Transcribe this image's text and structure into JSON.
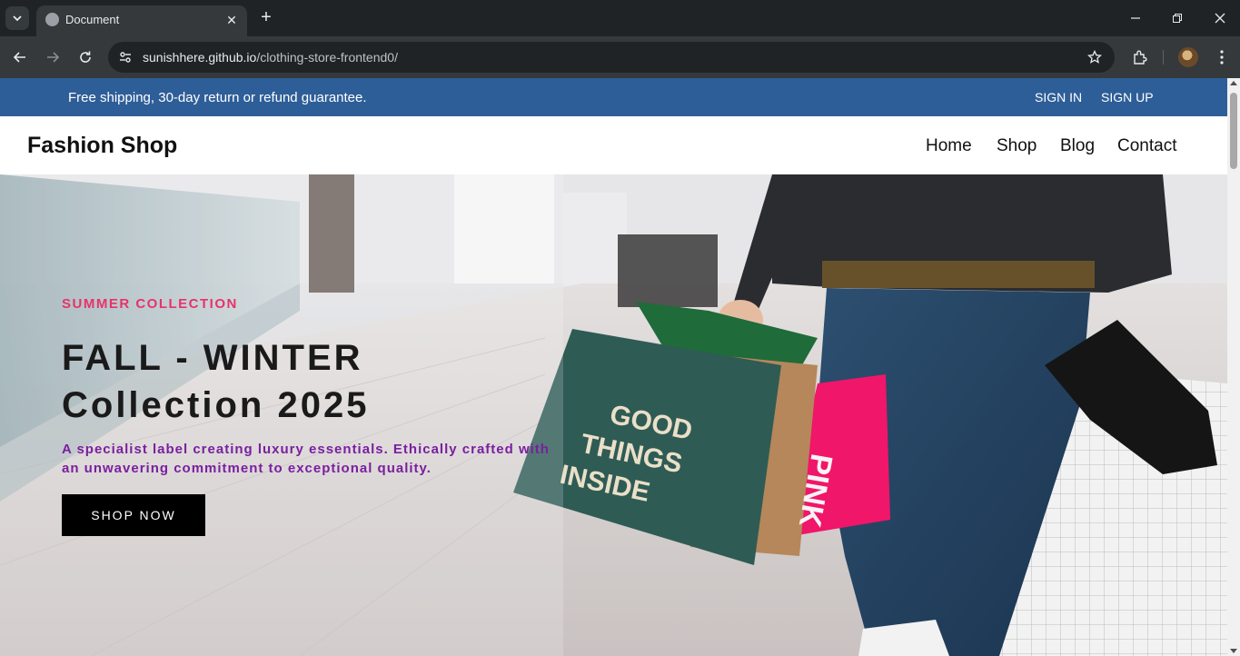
{
  "browser": {
    "tab_title": "Document",
    "url_host": "sunishhere.github.io",
    "url_path": "/clothing-store-frontend0/"
  },
  "announcement": {
    "text": "Free shipping, 30-day return or refund guarantee.",
    "sign_in": "SIGN IN",
    "sign_up": "SIGN UP"
  },
  "header": {
    "brand": "Fashion Shop",
    "nav": [
      "Home",
      "Shop",
      "Blog",
      "Contact"
    ]
  },
  "hero": {
    "tag": "SUMMER COLLECTION",
    "title_line1": "FALL - WINTER",
    "title_line2": "Collection 2025",
    "description": "A specialist label creating luxury essentials. Ethically crafted with an unwavering commitment to exceptional quality.",
    "button": "SHOP NOW",
    "bag1_text": "GOOD THINGS INSIDE",
    "bag2_text": "PINK"
  },
  "colors": {
    "announcement_bg": "#2e5e98",
    "hero_tag": "#e7336b",
    "hero_desc": "#7a1fa0",
    "button_bg": "#000000"
  }
}
